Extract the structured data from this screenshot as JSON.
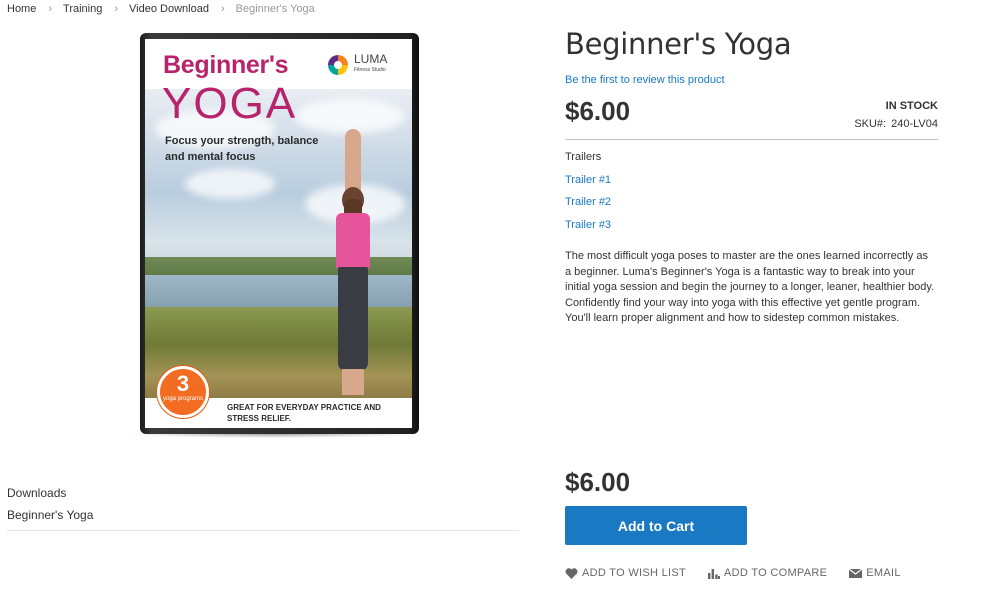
{
  "breadcrumbs": {
    "items": [
      "Home",
      "Training",
      "Video Download"
    ],
    "current": "Beginner's Yoga"
  },
  "cover": {
    "title_line1": "Beginner's",
    "title_line2": "YOGA",
    "tagline": "Focus your strength, balance and mental focus",
    "logo_name": "LUMA",
    "logo_sub": "Fitness Studio",
    "badge_number": "3",
    "badge_text": "yoga programs",
    "footer_text": "GREAT FOR EVERYDAY PRACTICE AND STRESS RELIEF."
  },
  "downloads": {
    "title": "Downloads",
    "item": "Beginner's Yoga"
  },
  "product": {
    "title": "Beginner's Yoga",
    "review_link": "Be the first to review this product",
    "price": "$6.00",
    "stock": "IN STOCK",
    "sku_label": "SKU#:",
    "sku_value": "240-LV04",
    "trailers_title": "Trailers",
    "trailers": [
      "Trailer #1",
      "Trailer #2",
      "Trailer #3"
    ],
    "description": "The most difficult yoga poses to master are the ones learned incorrectly as a beginner. Luma's Beginner's Yoga is a fantastic way to break into your initial yoga session and begin the journey to a longer, leaner, healthier body. Confidently find your way into yoga with this effective yet gentle program. You'll learn proper alignment and how to sidestep common mistakes.",
    "price_bottom": "$6.00",
    "add_to_cart": "Add to Cart"
  },
  "actions": {
    "wishlist": "ADD TO WISH LIST",
    "compare": "ADD TO COMPARE",
    "email": "EMAIL"
  },
  "colors": {
    "link": "#1979c3",
    "button": "#1979c3",
    "cover_title": "#b7246c",
    "badge": "#f26d21"
  },
  "icons": {
    "breadcrumb_separator": "chevron-right-icon",
    "wishlist": "heart-icon",
    "compare": "bar-chart-icon",
    "email": "envelope-icon"
  }
}
